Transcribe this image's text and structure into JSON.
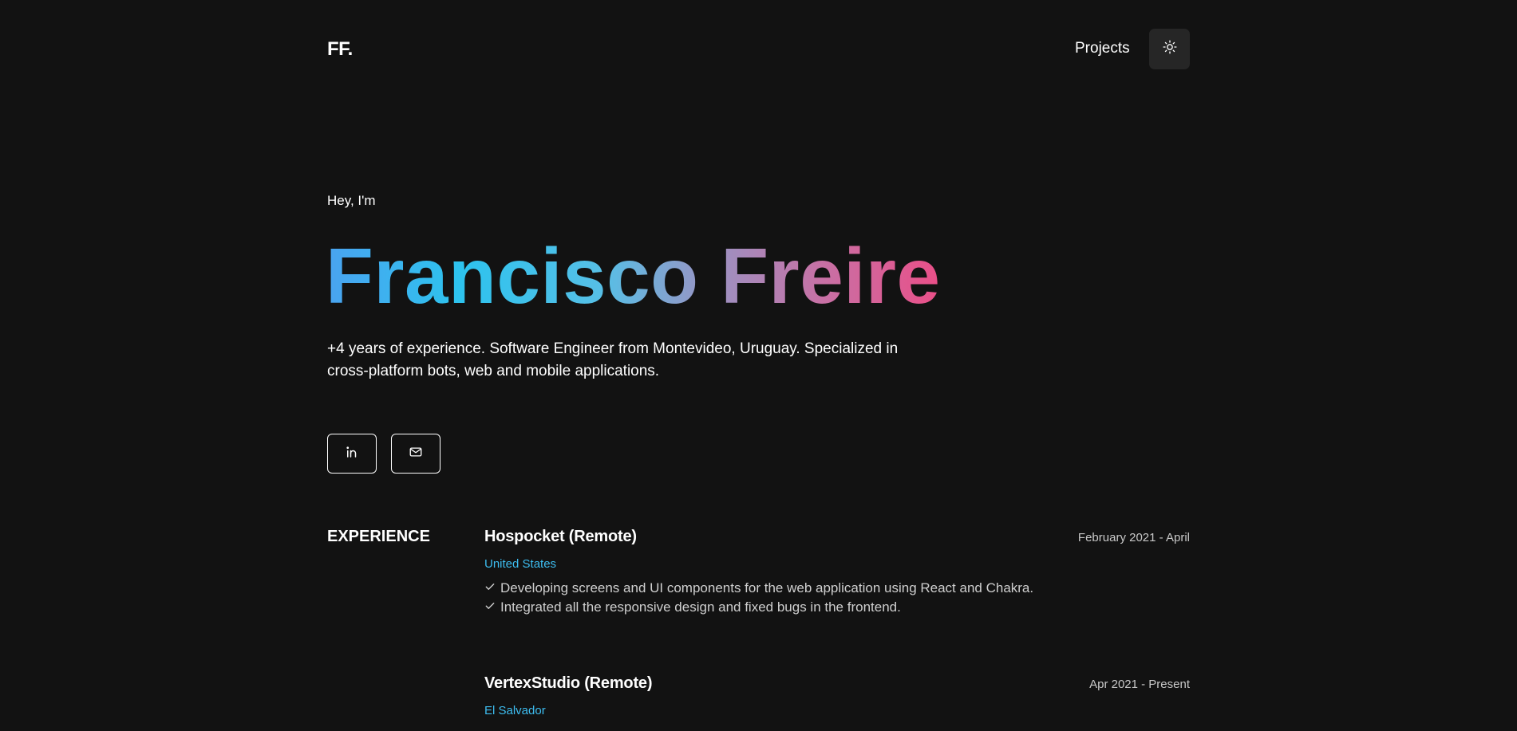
{
  "header": {
    "logo": "FF.",
    "nav": [
      {
        "label": "Projects"
      }
    ],
    "theme_toggle_icon": "sun-icon"
  },
  "hero": {
    "greeting": "Hey, I'm",
    "name": "Francisco Freire",
    "bio": "+4 years of experience. Software Engineer from Montevideo, Uruguay. Specialized in cross-platform bots, web and mobile applications.",
    "social": [
      {
        "icon": "linkedin-icon"
      },
      {
        "icon": "mail-icon"
      }
    ],
    "gradient": [
      "#4aa3f0",
      "#2dc3ee",
      "#57bfe6",
      "#9994c4",
      "#c672a6",
      "#ea4f88"
    ]
  },
  "experience": {
    "heading": "EXPERIENCE",
    "jobs": [
      {
        "title": "Hospocket (Remote)",
        "date": "February 2021 - April",
        "location": "United States",
        "tasks": [
          "Developing screens and UI components for the web application using React and Chakra.",
          "Integrated all the responsive design and fixed bugs in the frontend."
        ]
      },
      {
        "title": "VertexStudio (Remote)",
        "date": "Apr 2021 - Present",
        "location": "El Salvador",
        "tasks": []
      }
    ]
  },
  "colors": {
    "background": "#121212",
    "accent": "#3dbdf0",
    "toggle_bg": "#262626"
  }
}
